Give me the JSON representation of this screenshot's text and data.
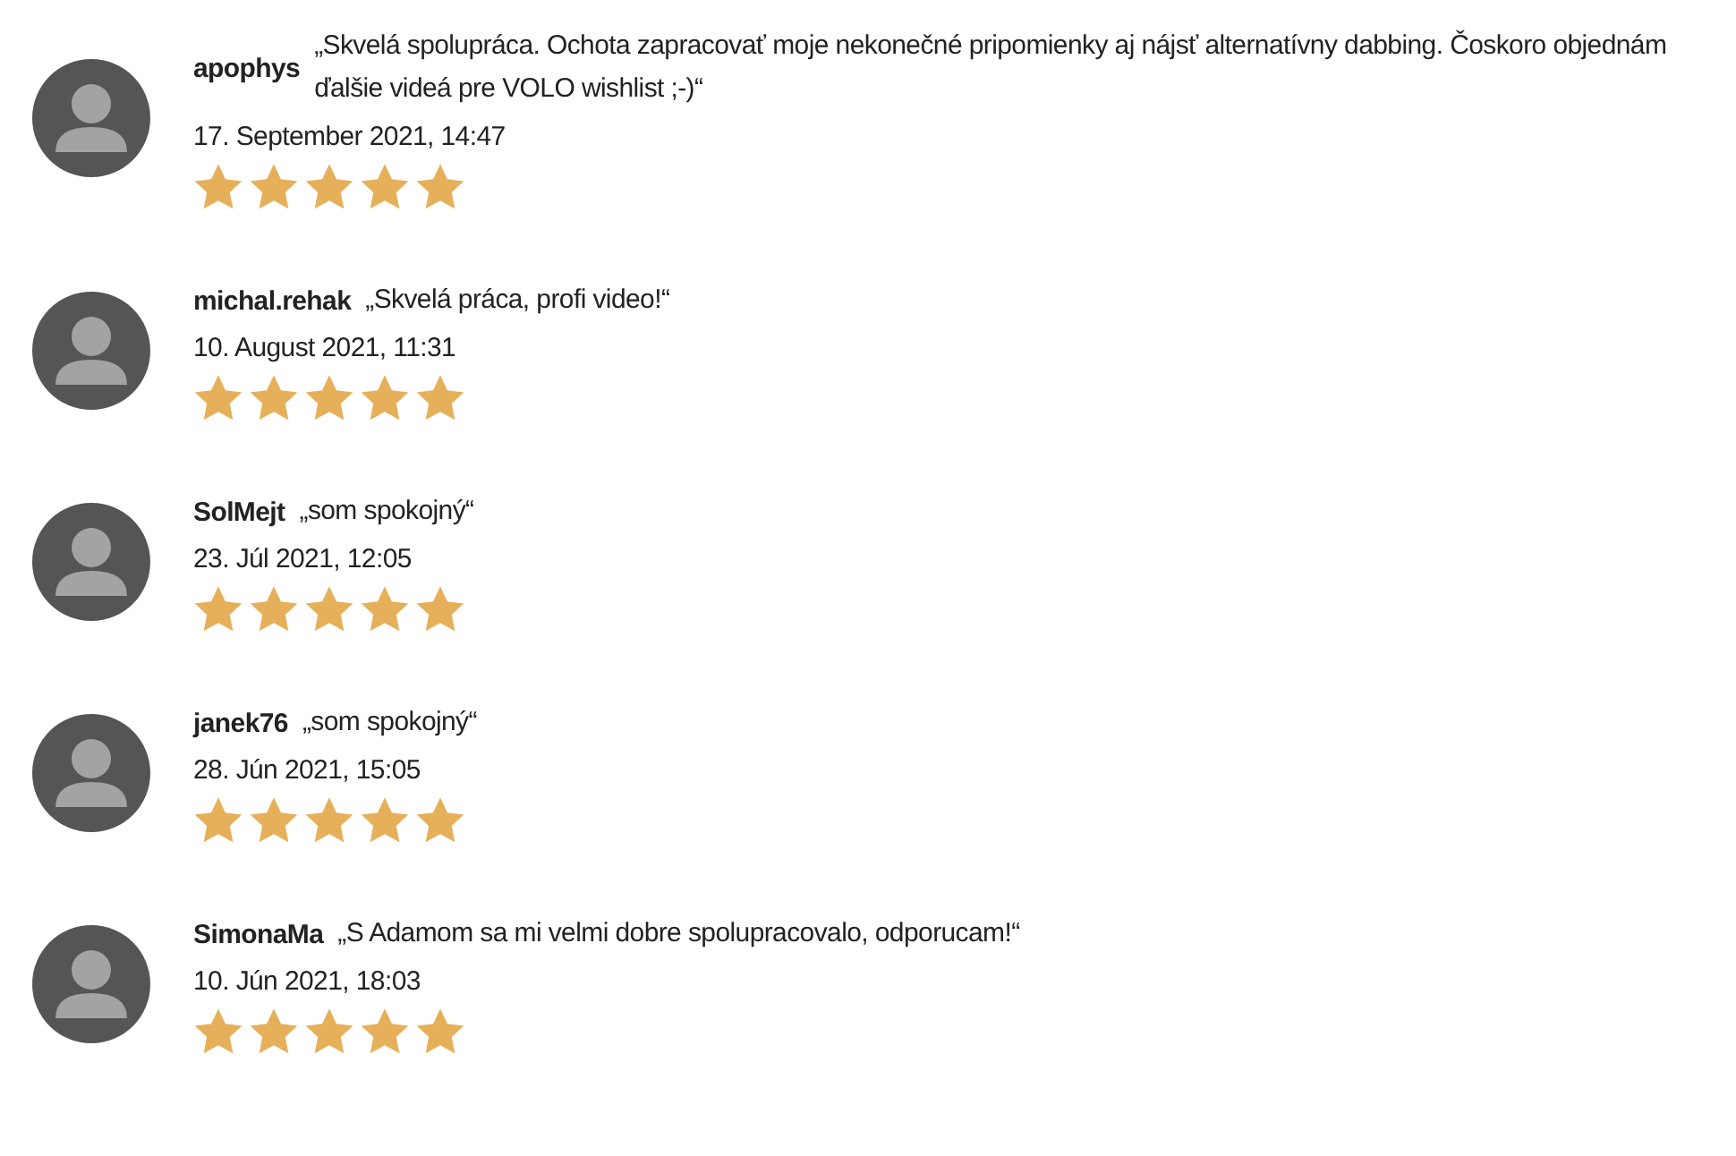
{
  "reviews": [
    {
      "user": "apophys",
      "comment": "„Skvelá spolupráca. Ochota zapracovať moje nekonečné pripomienky aj nájsť alternatívny dabbing. Čoskoro objednám ďalšie videá pre VOLO wishlist ;-)“",
      "date": "17. September 2021, 14:47",
      "stars": 5
    },
    {
      "user": "michal.rehak",
      "comment": "„Skvelá práca, profi video!“",
      "date": "10. August 2021, 11:31",
      "stars": 5
    },
    {
      "user": "SolMejt",
      "comment": "„som spokojný“",
      "date": "23. Júl 2021, 12:05",
      "stars": 5
    },
    {
      "user": "janek76",
      "comment": "„som spokojný“",
      "date": "28. Jún 2021, 15:05",
      "stars": 5
    },
    {
      "user": "SimonaMa",
      "comment": "„S Adamom sa mi velmi dobre spolupracovalo, odporucam!“",
      "date": "10. Jún 2021, 18:03",
      "stars": 5
    }
  ]
}
